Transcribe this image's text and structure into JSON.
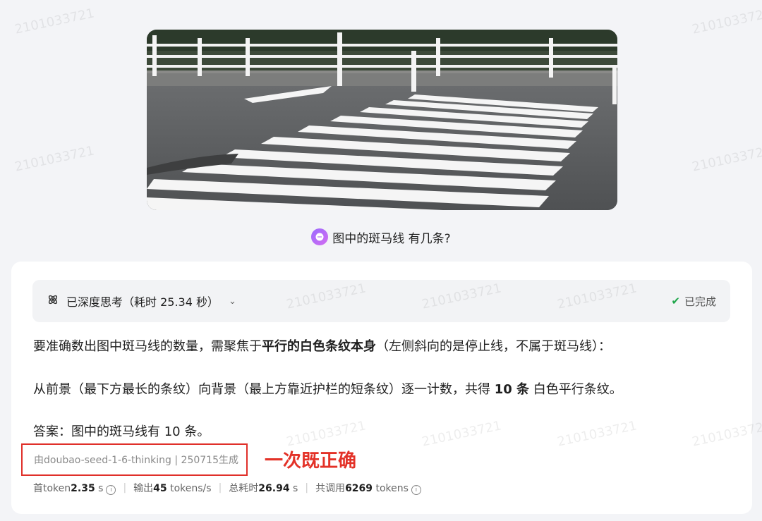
{
  "question": {
    "text": "图中的斑马线 有几条?"
  },
  "think": {
    "label": "已深度思考（耗时 25.34 秒）",
    "status": "已完成"
  },
  "answer": {
    "p1_pre": "要准确数出图中斑马线的数量，需聚焦于",
    "p1_bold": "平行的白色条纹本身",
    "p1_post": "（左侧斜向的是停止线，不属于斑马线）：",
    "p2_pre": "从前景（最下方最长的条纹）向背景（最上方靠近护栏的短条纹）逐一计数，共得 ",
    "p2_bold": "10 条",
    "p2_post": " 白色平行条纹。",
    "p3": "答案：图中的斑马线有 10 条。"
  },
  "model_tag": "由doubao-seed-1-6-thinking | 250715生成",
  "annotation": "一次既正确",
  "stats": {
    "first_token_label": "首token",
    "first_token_value": "2.35",
    "first_token_unit": "s",
    "output_label": "输出",
    "output_value": "45",
    "output_unit": "tokens/s",
    "total_label": "总耗时",
    "total_value": "26.94",
    "total_unit": "s",
    "calls_label": "共调用",
    "calls_value": "6269",
    "calls_unit": "tokens"
  },
  "watermark": "2101033721"
}
